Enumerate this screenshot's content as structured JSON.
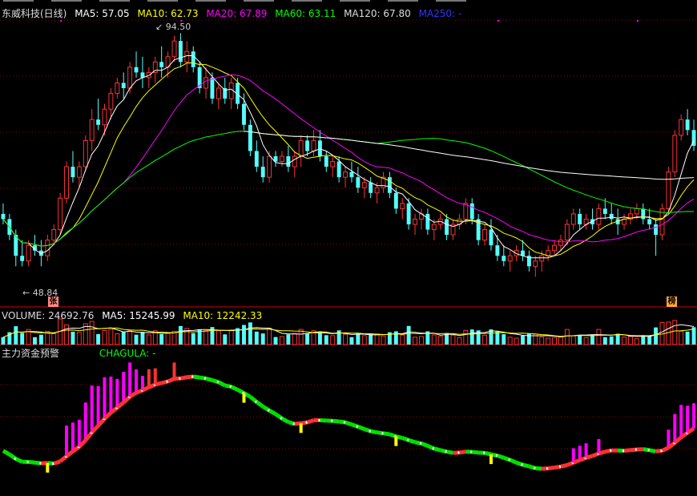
{
  "price_panel": {
    "title": "东威科技(日线)",
    "ma5": "MA5: 57.05",
    "ma10": "MA10: 62.73",
    "ma20": "MA20: 67.89",
    "ma60": "MA60: 63.11",
    "ma120": "MA120: 67.80",
    "ma250": "MA250: -",
    "high_label": "94.50",
    "low_label": "48.84",
    "tag_left": "张",
    "tag_right": "榜"
  },
  "volume_panel": {
    "vol": "VOLUME: 24692.76",
    "ma5": "MA5: 15245.99",
    "ma10": "MA10: 12242.33"
  },
  "indicator_panel": {
    "title": "主力资金预警",
    "chagula": "CHAGULA: -"
  },
  "colors": {
    "up": "#ff3232",
    "down": "#54ffff",
    "ma5": "#ffffff",
    "ma10": "#ffff00",
    "ma20": "#ff00ff",
    "ma60": "#00ff00",
    "ma120": "#ffffff",
    "ma250": "#0000ff",
    "grid": "#8b0000"
  },
  "chart_data": {
    "type": "candlestick",
    "price_range": [
      45,
      97
    ],
    "high_marker": 94.5,
    "low_marker": 48.84,
    "candles": [
      [
        60,
        62,
        58,
        59
      ],
      [
        59,
        60,
        55,
        56
      ],
      [
        56,
        57,
        50,
        52
      ],
      [
        52,
        55,
        50,
        51
      ],
      [
        51,
        55,
        50,
        54
      ],
      [
        54,
        56,
        52,
        53
      ],
      [
        53,
        55,
        50,
        52
      ],
      [
        52,
        56,
        51,
        55
      ],
      [
        55,
        58,
        54,
        57
      ],
      [
        57,
        64,
        56,
        63
      ],
      [
        63,
        70,
        62,
        69
      ],
      [
        69,
        72,
        66,
        67
      ],
      [
        67,
        70,
        65,
        69
      ],
      [
        69,
        75,
        68,
        74
      ],
      [
        74,
        80,
        72,
        78
      ],
      [
        78,
        82,
        76,
        77
      ],
      [
        77,
        81,
        75,
        80
      ],
      [
        80,
        84,
        78,
        83
      ],
      [
        83,
        86,
        82,
        85
      ],
      [
        85,
        87,
        82,
        84
      ],
      [
        84,
        89,
        83,
        88
      ],
      [
        88,
        91,
        86,
        87
      ],
      [
        87,
        90,
        84,
        86
      ],
      [
        86,
        88,
        84,
        87
      ],
      [
        87,
        90,
        85,
        89
      ],
      [
        89,
        92,
        86,
        88
      ],
      [
        88,
        91,
        86,
        90
      ],
      [
        90,
        94,
        89,
        93
      ],
      [
        93,
        94.5,
        88,
        89
      ],
      [
        89,
        93,
        87,
        91
      ],
      [
        91,
        92,
        87,
        88
      ],
      [
        88,
        89,
        83,
        84
      ],
      [
        84,
        88,
        82,
        86
      ],
      [
        86,
        87,
        81,
        82
      ],
      [
        82,
        85,
        80,
        84
      ],
      [
        84,
        86,
        81,
        82
      ],
      [
        82,
        86,
        80,
        85
      ],
      [
        85,
        86,
        80,
        81
      ],
      [
        81,
        83,
        76,
        77
      ],
      [
        77,
        78,
        71,
        72
      ],
      [
        72,
        74,
        68,
        69
      ],
      [
        69,
        71,
        66,
        67
      ],
      [
        67,
        72,
        66,
        71
      ],
      [
        71,
        72,
        69,
        70
      ],
      [
        70,
        72,
        69,
        71
      ],
      [
        71,
        73,
        68,
        69
      ],
      [
        69,
        72,
        67,
        71
      ],
      [
        71,
        75,
        69,
        74
      ],
      [
        74,
        75,
        71,
        72
      ],
      [
        72,
        76,
        71,
        74
      ],
      [
        74,
        76,
        70,
        71
      ],
      [
        71,
        72,
        68,
        69
      ],
      [
        69,
        71,
        67,
        70
      ],
      [
        70,
        71,
        66,
        67
      ],
      [
        67,
        69,
        65,
        68
      ],
      [
        68,
        70,
        66,
        67
      ],
      [
        67,
        69,
        64,
        65
      ],
      [
        65,
        67,
        63,
        66
      ],
      [
        66,
        67,
        63,
        64
      ],
      [
        64,
        66,
        62,
        65
      ],
      [
        65,
        68,
        64,
        67
      ],
      [
        67,
        68,
        63,
        64
      ],
      [
        64,
        65,
        60,
        61
      ],
      [
        61,
        63,
        59,
        62
      ],
      [
        62,
        63,
        57,
        58
      ],
      [
        58,
        60,
        56,
        59
      ],
      [
        59,
        61,
        57,
        60
      ],
      [
        60,
        61,
        56,
        57
      ],
      [
        57,
        59,
        55,
        58
      ],
      [
        58,
        60,
        57,
        59
      ],
      [
        59,
        60,
        55,
        56
      ],
      [
        56,
        59,
        55,
        58
      ],
      [
        58,
        60,
        57,
        59
      ],
      [
        59,
        63,
        58,
        62
      ],
      [
        62,
        63,
        58,
        59
      ],
      [
        59,
        60,
        54,
        55
      ],
      [
        55,
        58,
        54,
        57
      ],
      [
        57,
        59,
        53,
        54
      ],
      [
        54,
        56,
        51,
        52
      ],
      [
        52,
        54,
        50,
        51
      ],
      [
        51,
        53,
        49,
        52
      ],
      [
        52,
        54,
        51,
        53
      ],
      [
        53,
        55,
        51,
        52
      ],
      [
        52,
        53,
        49,
        50
      ],
      [
        50,
        52,
        48,
        51
      ],
      [
        51,
        53,
        49,
        52
      ],
      [
        52,
        54,
        51,
        53
      ],
      [
        53,
        55,
        52,
        54
      ],
      [
        54,
        56,
        53,
        55
      ],
      [
        55,
        59,
        54,
        58
      ],
      [
        58,
        61,
        57,
        60
      ],
      [
        60,
        61,
        57,
        58
      ],
      [
        58,
        60,
        57,
        59
      ],
      [
        59,
        61,
        57,
        58
      ],
      [
        58,
        62,
        57,
        61
      ],
      [
        61,
        63,
        59,
        60
      ],
      [
        60,
        62,
        58,
        59
      ],
      [
        59,
        61,
        56,
        58
      ],
      [
        58,
        60,
        57,
        59
      ],
      [
        59,
        61,
        58,
        60
      ],
      [
        60,
        62,
        59,
        61
      ],
      [
        61,
        62,
        58,
        59
      ],
      [
        59,
        61,
        57,
        58
      ],
      [
        58,
        59,
        52,
        56
      ],
      [
        56,
        62,
        55,
        61
      ],
      [
        61,
        69,
        60,
        68
      ],
      [
        68,
        76,
        67,
        75
      ],
      [
        75,
        79,
        74,
        78
      ],
      [
        78,
        80,
        75,
        76
      ],
      [
        76,
        78,
        72,
        73
      ]
    ]
  }
}
